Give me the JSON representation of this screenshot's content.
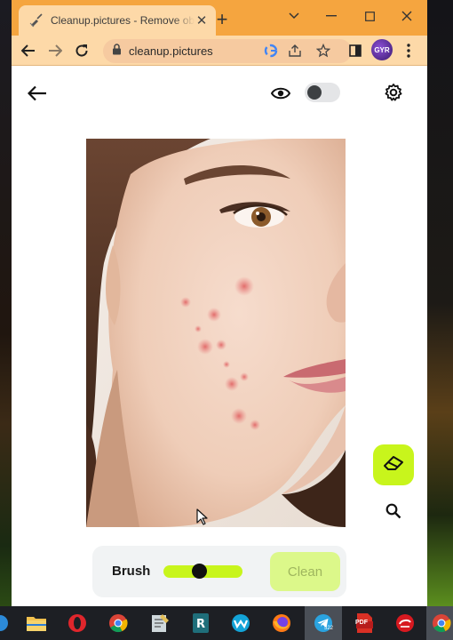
{
  "browser": {
    "tab_title": "Cleanup.pictures - Remove ob",
    "url": "cleanup.pictures",
    "profile_initials": "GYR",
    "icons": {
      "new_tab": "plus-icon",
      "back": "arrow-left-icon",
      "forward": "arrow-right-icon",
      "reload": "reload-icon",
      "lock": "lock-icon",
      "google": "google-icon",
      "share": "share-icon",
      "bookmark": "star-icon",
      "sidepanel": "side-panel-icon",
      "menu": "kebab-menu-icon"
    }
  },
  "app": {
    "icons": {
      "back": "arrow-left-icon",
      "preview": "eye-icon",
      "settings": "gear-icon",
      "eraser": "eraser-icon",
      "zoom": "magnifier-icon"
    },
    "toggle_on": false,
    "brush": {
      "label": "Brush",
      "slider_value_fraction": 0.44
    },
    "clean_button": "Clean",
    "accent_color": "#c8f51c"
  },
  "taskbar": {
    "telegram_badge": "522",
    "pdf_label": "PDF",
    "apps": [
      "edge-icon",
      "file-explorer-icon",
      "opera-icon",
      "chrome-icon",
      "notepad-icon",
      "r-app-icon",
      "webex-icon",
      "firefox-icon",
      "telegram-icon",
      "pdf-icon",
      "trend-micro-icon",
      "chrome-active-icon"
    ]
  }
}
